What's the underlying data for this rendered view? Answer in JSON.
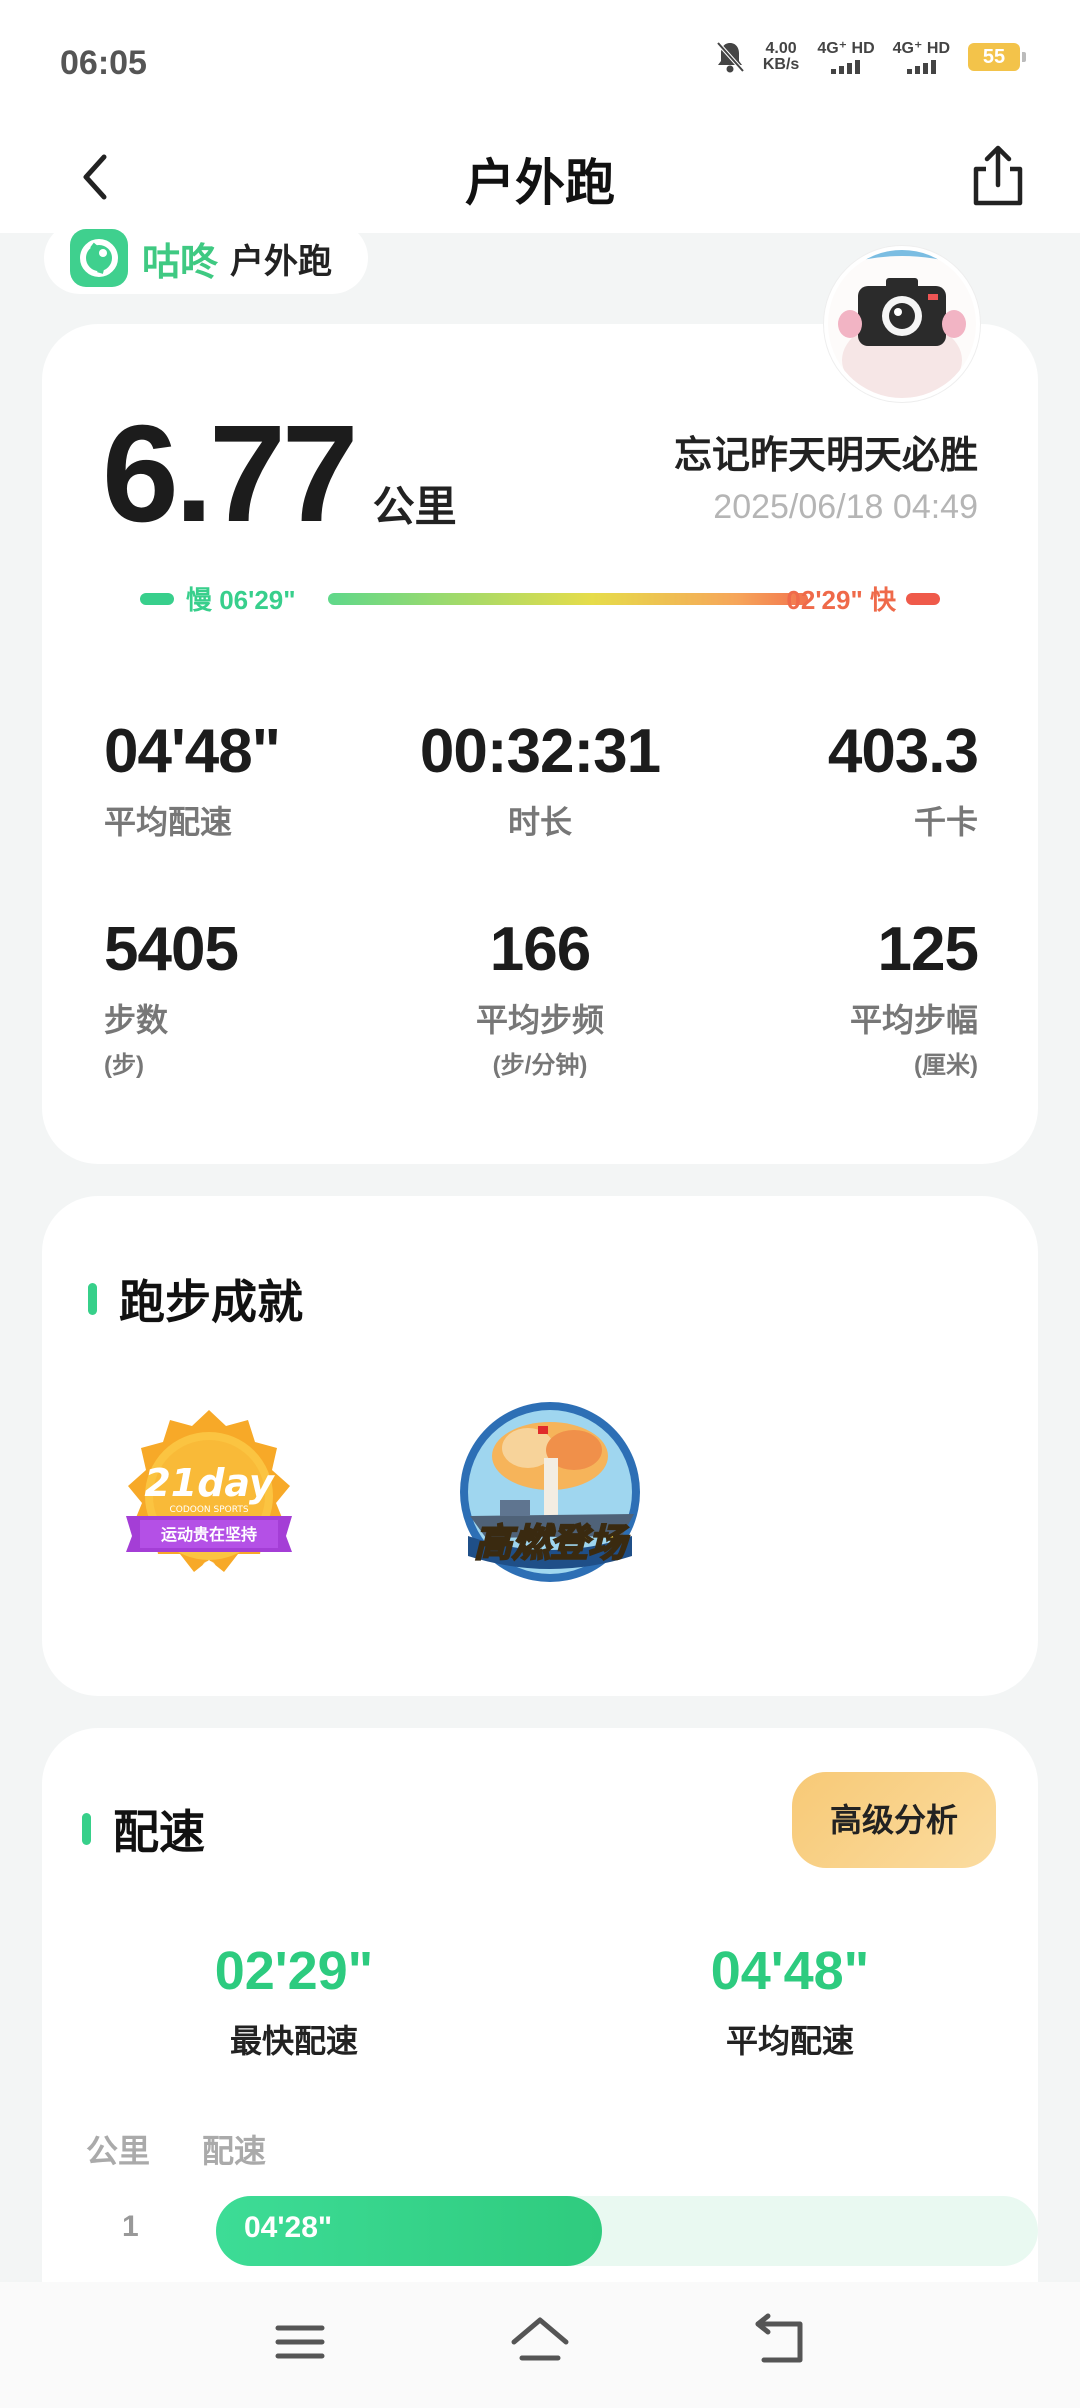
{
  "status": {
    "time": "06:05",
    "net_speed_value": "4.00",
    "net_speed_unit": "KB/s",
    "sim1": "4G⁺ HD",
    "sim2": "4G⁺ HD",
    "battery": "55",
    "battery_color": "#f3c34a"
  },
  "header": {
    "title": "户外跑",
    "back_icon": "chevron-left-icon",
    "share_icon": "share-icon"
  },
  "brand": {
    "name": "咕咚",
    "sub": "户外跑",
    "color": "#3fc982"
  },
  "summary": {
    "distance": "6.77",
    "distance_unit": "公里",
    "user_name": "忘记昨天明天必胜",
    "date": "2025/06/18 04:49",
    "slow_label": "慢 06'29\"",
    "fast_label": "02'29\" 快"
  },
  "stats": [
    {
      "value": "04'48\"",
      "label": "平均配速",
      "unit": ""
    },
    {
      "value": "00:32:31",
      "label": "时长",
      "unit": ""
    },
    {
      "value": "403.3",
      "label": "千卡",
      "unit": ""
    },
    {
      "value": "5405",
      "label": "步数",
      "unit": "(步)"
    },
    {
      "value": "166",
      "label": "平均步频",
      "unit": "(步/分钟)"
    },
    {
      "value": "125",
      "label": "平均步幅",
      "unit": "(厘米)"
    }
  ],
  "achievements": {
    "title": "跑步成就",
    "badges": [
      {
        "icon": "badge-21day-icon",
        "text": "21day",
        "sub": "CODOON SPORTS",
        "ribbon": "运动贵在坚持"
      },
      {
        "icon": "badge-gaoran-icon",
        "text": "高燃登场"
      }
    ]
  },
  "pace": {
    "title": "配速",
    "advanced_button": "高级分析",
    "fastest_value": "02'29\"",
    "fastest_label": "最快配速",
    "average_value": "04'48\"",
    "average_label": "平均配速",
    "col_km": "公里",
    "col_pace": "配速",
    "splits": [
      {
        "km": "1",
        "pace": "04'28\"",
        "fraction": 0.47
      }
    ],
    "accent": "#2dcb7f"
  },
  "nav": {
    "menu_icon": "menu-icon",
    "home_icon": "home-icon",
    "back_icon": "back-icon"
  }
}
